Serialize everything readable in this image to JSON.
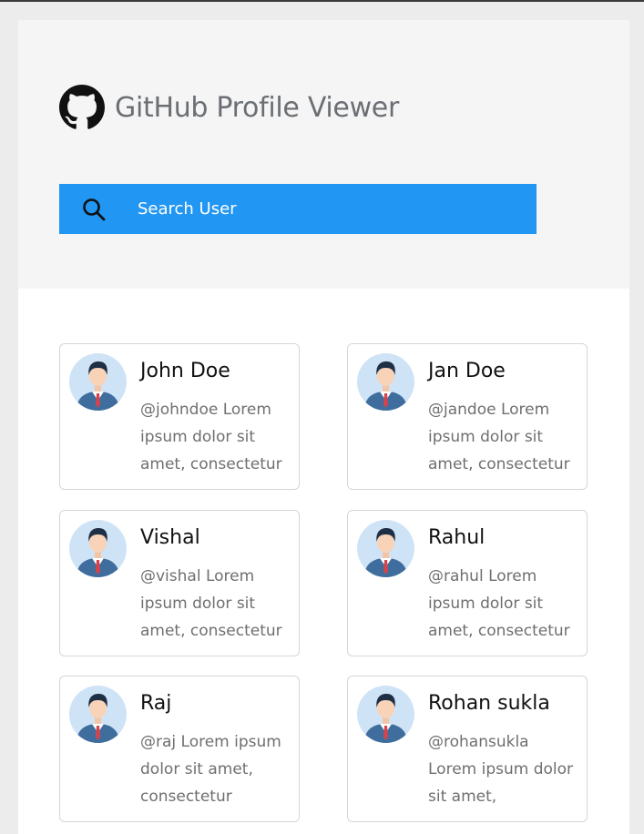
{
  "app": {
    "title": "GitHub Profile Viewer",
    "logo_icon": "github-icon"
  },
  "search": {
    "placeholder": "Search User",
    "icon": "search-icon",
    "accent": "#2196f3"
  },
  "users": [
    {
      "name": "John Doe",
      "desc": "@johndoe Lorem ipsum dolor sit amet, consectetur"
    },
    {
      "name": "Jan Doe",
      "desc": "@jandoe Lorem ipsum dolor sit amet, consectetur"
    },
    {
      "name": "Vishal",
      "desc": "@vishal Lorem ipsum dolor sit amet, consectetur"
    },
    {
      "name": "Rahul",
      "desc": "@rahul Lorem ipsum dolor sit amet, consectetur"
    },
    {
      "name": "Raj",
      "desc": "@raj Lorem ipsum dolor sit amet, consectetur"
    },
    {
      "name": "Rohan sukla",
      "desc": "@rohansukla Lorem ipsum dolor sit amet,"
    }
  ]
}
